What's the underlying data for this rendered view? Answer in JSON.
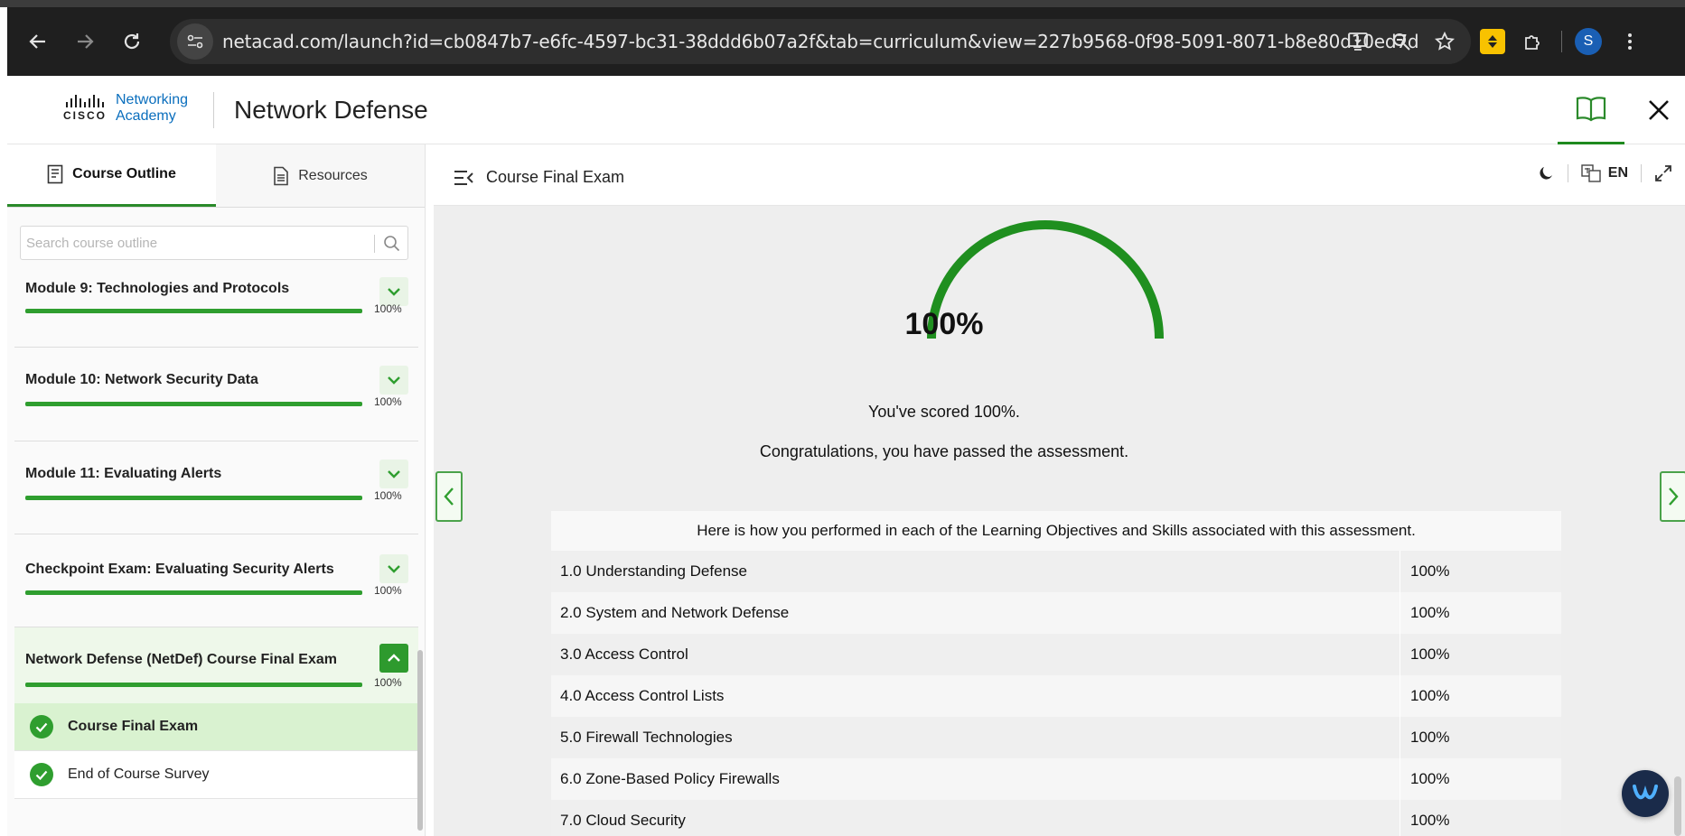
{
  "browser": {
    "url": "netacad.com/launch?id=cb0847b7-e6fc-4597-bc31-38ddd6b07a2f&tab=curriculum&view=227b9568-0f98-5091-8071-b8e80d10ed7d",
    "profile_initial": "S"
  },
  "app": {
    "logo_text": "Networking",
    "logo_text2": "Academy",
    "logo_brand": "CISCO",
    "title": "Network Defense"
  },
  "sidebar": {
    "tabs": [
      {
        "label": "Course Outline",
        "active": true
      },
      {
        "label": "Resources",
        "active": false
      }
    ],
    "search_placeholder": "Search course outline",
    "modules": [
      {
        "title": "Module 9: Technologies and Protocols",
        "progress": "100%",
        "progress_value": 1.0
      },
      {
        "title": "Module 10: Network Security Data",
        "progress": "100%",
        "progress_value": 1.0
      },
      {
        "title": "Module 11: Evaluating Alerts",
        "progress": "100%",
        "progress_value": 1.0
      },
      {
        "title": "Checkpoint Exam: Evaluating Security Alerts",
        "progress": "100%",
        "progress_value": 1.0
      },
      {
        "title": "Network Defense (NetDef) Course Final Exam",
        "progress": "100%",
        "progress_value": 1.0
      }
    ],
    "sub_items": [
      {
        "label": "Course Final Exam",
        "active": true
      },
      {
        "label": "End of Course Survey",
        "active": false
      }
    ]
  },
  "content": {
    "title": "Course Final Exam",
    "lang": "EN",
    "score_display": "100%",
    "score_value": 1.0,
    "score_message": "You've scored 100%.",
    "pass_message": "Congratulations, you have passed the assessment.",
    "results_header": "Here is how you performed in each of the Learning Objectives and Skills associated with this assessment.",
    "results": [
      {
        "objective": "1.0 Understanding Defense",
        "score": "100%"
      },
      {
        "objective": "2.0 System and Network Defense",
        "score": "100%"
      },
      {
        "objective": "3.0 Access Control",
        "score": "100%"
      },
      {
        "objective": "4.0 Access Control Lists",
        "score": "100%"
      },
      {
        "objective": "5.0 Firewall Technologies",
        "score": "100%"
      },
      {
        "objective": "6.0 Zone-Based Policy Firewalls",
        "score": "100%"
      },
      {
        "objective": "7.0 Cloud Security",
        "score": "100%"
      }
    ]
  },
  "colors": {
    "accent_green": "#2f9e2f",
    "gauge_green": "#1f8f1f"
  }
}
